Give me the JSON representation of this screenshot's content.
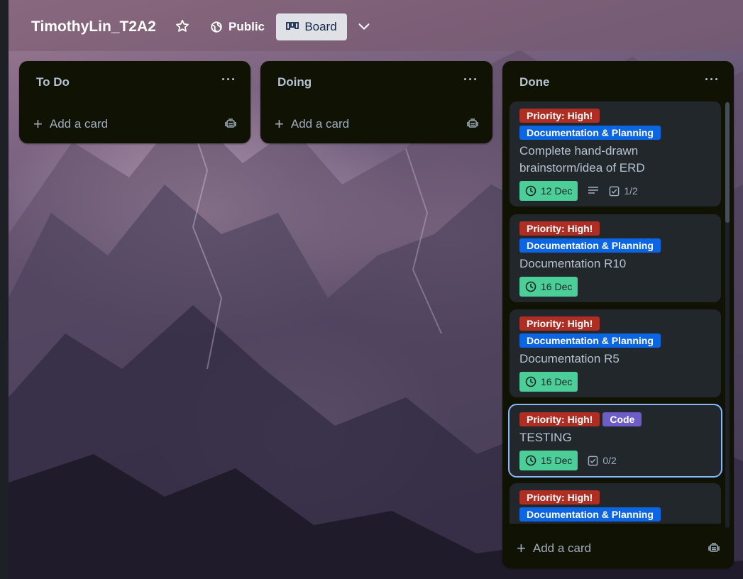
{
  "header": {
    "board_title": "TimothyLin_T2A2",
    "visibility_label": "Public",
    "view_label": "Board"
  },
  "icons": {
    "star": "star-icon",
    "visibility": "globe-icon",
    "board": "board-icon",
    "chevron": "chevron-down-icon",
    "list_menu": "ellipsis-icon",
    "add": "plus-icon",
    "template": "card-template-icon",
    "clock": "clock-icon",
    "description": "description-icon",
    "checklist": "checklist-icon"
  },
  "colors": {
    "label_red": "#ae2e24",
    "label_blue": "#0c66e4",
    "label_purple": "#6e5dc6",
    "due_green": "#4bce97"
  },
  "lists": {
    "todo": {
      "title": "To Do",
      "menu": "···",
      "add_label": "Add a card"
    },
    "doing": {
      "title": "Doing",
      "menu": "···",
      "add_label": "Add a card"
    },
    "done": {
      "title": "Done",
      "menu": "···",
      "add_label": "Add a card",
      "cards": [
        {
          "labels": [
            "Priority: High!",
            "Documentation & Planning"
          ],
          "title": "Complete hand-drawn brainstorm/idea of ERD",
          "due": "12 Dec",
          "checklist": "1/2"
        },
        {
          "labels": [
            "Priority: High!",
            "Documentation & Planning"
          ],
          "title": "Documentation R10",
          "due": "16 Dec"
        },
        {
          "labels": [
            "Priority: High!",
            "Documentation & Planning"
          ],
          "title": "Documentation R5",
          "due": "16 Dec"
        },
        {
          "labels": [
            "Priority: High!",
            "Code"
          ],
          "title": "TESTING",
          "due": "15 Dec",
          "checklist": "0/2"
        },
        {
          "labels": [
            "Priority: High!",
            "Documentation & Planning"
          ]
        }
      ]
    }
  }
}
